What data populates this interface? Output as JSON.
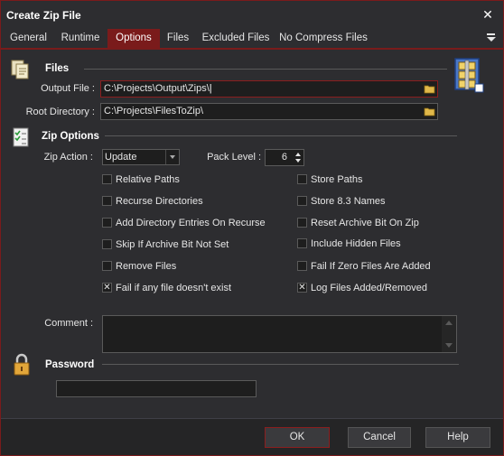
{
  "window": {
    "title": "Create Zip File"
  },
  "tabs": [
    {
      "label": "General"
    },
    {
      "label": "Runtime"
    },
    {
      "label": "Options"
    },
    {
      "label": "Files"
    },
    {
      "label": "Excluded Files"
    },
    {
      "label": "No Compress Files"
    }
  ],
  "files_section": {
    "title": "Files",
    "output_file_label": "Output File :",
    "output_file_value": "C:\\Projects\\Output\\Zips\\",
    "root_dir_label": "Root Directory :",
    "root_dir_value": "C:\\Projects\\FilesToZip\\"
  },
  "zip_options": {
    "title": "Zip Options",
    "zip_action_label": "Zip Action :",
    "zip_action_value": "Update",
    "pack_level_label": "Pack Level :",
    "pack_level_value": "6",
    "left_checks": [
      {
        "label": "Relative Paths",
        "checked": false
      },
      {
        "label": "Recurse Directories",
        "checked": false
      },
      {
        "label": "Add Directory Entries On Recurse",
        "checked": false
      },
      {
        "label": "Skip If Archive Bit Not Set",
        "checked": false
      },
      {
        "label": "Remove Files",
        "checked": false
      },
      {
        "label": "Fail if any file doesn't exist",
        "checked": true
      }
    ],
    "right_checks": [
      {
        "label": "Store Paths",
        "checked": false
      },
      {
        "label": "Store 8.3 Names",
        "checked": false
      },
      {
        "label": "Reset Archive Bit On Zip",
        "checked": false
      },
      {
        "label": "Include Hidden Files",
        "checked": false
      },
      {
        "label": "Fail If Zero Files Are Added",
        "checked": false
      },
      {
        "label": "Log Files Added/Removed",
        "checked": true
      }
    ],
    "comment_label": "Comment :"
  },
  "password_section": {
    "title": "Password",
    "value": ""
  },
  "footer": {
    "ok_label": "OK",
    "cancel_label": "Cancel",
    "help_label": "Help"
  },
  "colors": {
    "accent": "#7a1b1b",
    "background": "#2d2d30",
    "input_bg": "#1e1e1e"
  },
  "icons": {
    "files_section": "files-icon",
    "zip_options": "checklist-icon",
    "password": "padlock-icon",
    "app": "winzip-archive-icon",
    "browse": "folder-icon"
  }
}
